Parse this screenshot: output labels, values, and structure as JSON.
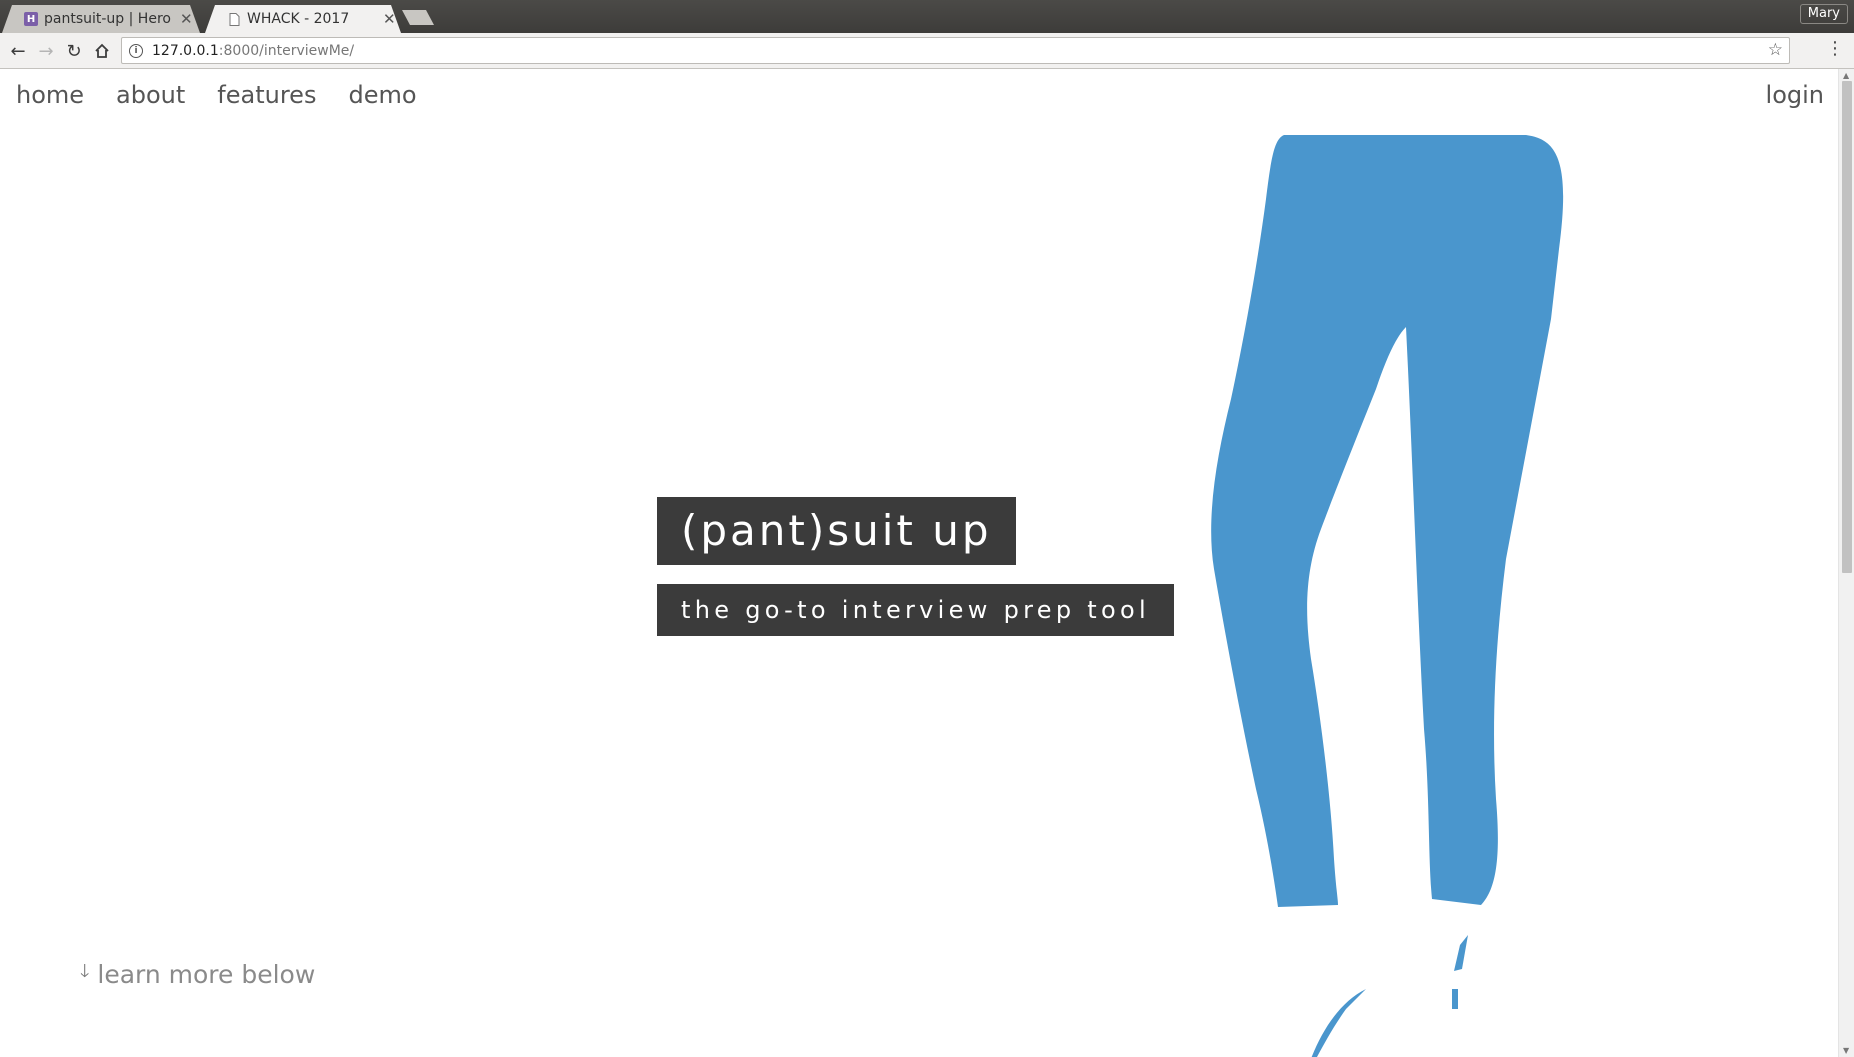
{
  "browser": {
    "tabs": [
      {
        "title": "pantsuit-up | Herok",
        "favicon": "heroku-icon",
        "favicon_letter": "H",
        "favicon_color": "#7b5fa8",
        "active": false
      },
      {
        "title": "WHACK - 2017",
        "favicon": "page-icon",
        "favicon_letter": "",
        "favicon_color": "#888888",
        "active": true
      }
    ],
    "profile_name": "Mary",
    "url_host": "127.0.0.1",
    "url_rest": ":8000/interviewMe/"
  },
  "nav": {
    "items": [
      {
        "label": "home"
      },
      {
        "label": "about"
      },
      {
        "label": "features"
      },
      {
        "label": "demo"
      }
    ],
    "login": "login"
  },
  "hero": {
    "title": "(pant)suit up",
    "subtitle": "the go-to interview prep tool",
    "illustration": "blue-pants-illustration"
  },
  "footer_hint": {
    "label": "learn more below",
    "icon": "arrow-down-icon"
  },
  "colors": {
    "pants": "#4a96cd",
    "hero_box": "#3b3b3b",
    "nav_text": "#555555"
  }
}
